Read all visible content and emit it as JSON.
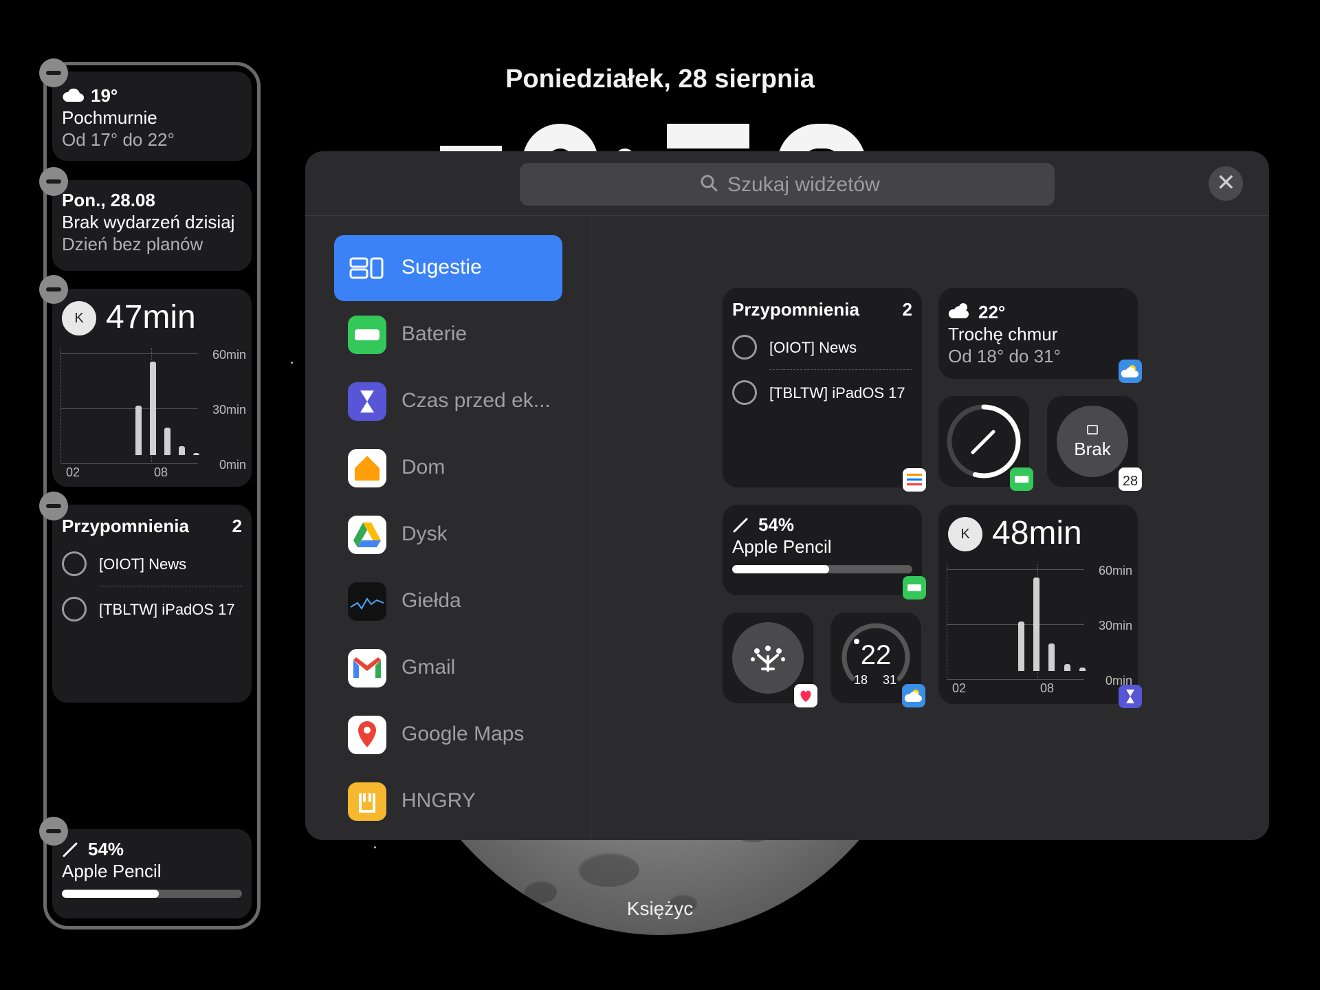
{
  "lock_screen": {
    "date": "Poniedziałek, 28 sierpnia",
    "wallpaper_label": "Księżyc"
  },
  "left_widgets": {
    "weather": {
      "temp": "19°",
      "condition": "Pochmurnie",
      "range": "Od 17° do 22°",
      "icon": "cloud-icon"
    },
    "calendar": {
      "date": "Pon., 28.08",
      "events": "Brak wydarzeń dzisiaj",
      "subtitle": "Dzień bez planów"
    },
    "screen_time": {
      "avatar": "K",
      "total": "47min",
      "y_labels": [
        "60min",
        "30min",
        "0min"
      ],
      "x_labels": [
        "02",
        "08"
      ],
      "bars": [
        0,
        0,
        0,
        0,
        0,
        0,
        0,
        0,
        0,
        0,
        0.45,
        0,
        0.85,
        0,
        0.25,
        0,
        0.08,
        0,
        0.02
      ]
    },
    "reminders": {
      "title": "Przypomnienia",
      "count": "2",
      "items": [
        "[OIOT] News",
        "[TBLTW] iPadOS 17"
      ]
    },
    "pencil": {
      "percent": "54%",
      "name": "Apple Pencil",
      "level": 0.54
    }
  },
  "gallery": {
    "search_placeholder": "Szukaj widżetów",
    "close_icon": "close-icon",
    "categories": [
      {
        "label": "Sugestie",
        "icon": "suggestions-icon",
        "color": "#3a82f6",
        "active": true
      },
      {
        "label": "Baterie",
        "icon": "battery-app-icon",
        "color": "#34c759"
      },
      {
        "label": "Czas przed ek...",
        "icon": "screen-time-app-icon",
        "color": "#5856d6"
      },
      {
        "label": "Dom",
        "icon": "home-app-icon",
        "color": "#ff9f0a"
      },
      {
        "label": "Dysk",
        "icon": "drive-app-icon",
        "color": "#ffffff"
      },
      {
        "label": "Giełda",
        "icon": "stocks-app-icon",
        "color": "#000000"
      },
      {
        "label": "Gmail",
        "icon": "gmail-app-icon",
        "color": "#ffffff"
      },
      {
        "label": "Google Maps",
        "icon": "maps-app-icon",
        "color": "#ffffff"
      },
      {
        "label": "HNGRY",
        "icon": "hngry-app-icon",
        "color": "#f5b82e"
      }
    ],
    "previews": {
      "reminders": {
        "title": "Przypomnienia",
        "count": "2",
        "items": [
          "[OIOT] News",
          "[TBLTW] iPadOS 17"
        ]
      },
      "weather": {
        "temp": "22°",
        "condition": "Trochę chmur",
        "range": "Od 18° do 31°"
      },
      "calendar_circle": {
        "label": "Brak",
        "badge_day": "28"
      },
      "pencil": {
        "percent": "54%",
        "name": "Apple Pencil",
        "level": 0.54
      },
      "temp_gauge": {
        "value": "22",
        "min": "18",
        "max": "31"
      },
      "screen_time": {
        "avatar": "K",
        "total": "48min",
        "y_labels": [
          "60min",
          "30min",
          "0min"
        ],
        "x_labels": [
          "02",
          "08"
        ],
        "bars": [
          0,
          0,
          0,
          0,
          0,
          0,
          0,
          0,
          0,
          0.45,
          0,
          0.85,
          0,
          0.25,
          0,
          0.06,
          0,
          0.03
        ]
      }
    }
  }
}
